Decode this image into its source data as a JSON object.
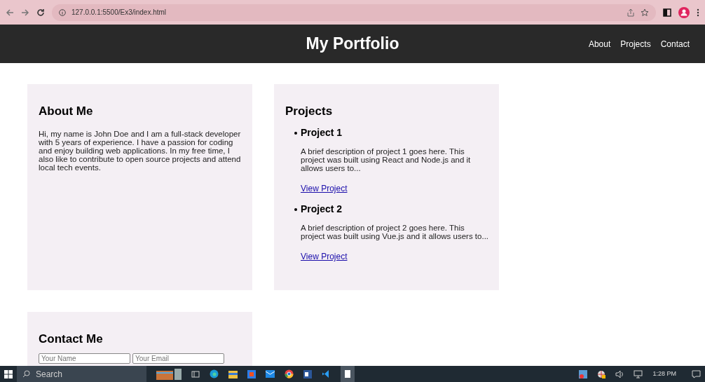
{
  "browser": {
    "url": "127.0.0.1:5500/Ex3/index.html"
  },
  "header": {
    "title": "My Portfolio",
    "nav": [
      "About",
      "Projects",
      "Contact"
    ]
  },
  "about": {
    "heading": "About Me",
    "text": "Hi, my name is John Doe and I am a full-stack developer with 5 years of experience. I have a passion for coding and enjoy building web applications. In my free time, I also like to contribute to open source projects and attend local tech events."
  },
  "projects": {
    "heading": "Projects",
    "items": [
      {
        "title": "Project 1",
        "description": "A brief description of project 1 goes here. This project was built using React and Node.js and it allows users to...",
        "link": "View Project"
      },
      {
        "title": "Project 2",
        "description": "A brief description of project 2 goes here. This project was built using Vue.js and it allows users to...",
        "link": "View Project"
      }
    ]
  },
  "contact": {
    "heading": "Contact Me",
    "fields": [
      {
        "placeholder": "Your Name"
      },
      {
        "placeholder": "Your Email"
      }
    ]
  },
  "taskbar": {
    "search": "Search",
    "time": "1:28 PM"
  }
}
